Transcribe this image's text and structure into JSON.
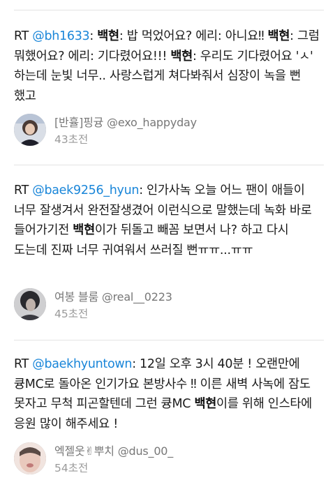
{
  "tweets": [
    {
      "rt": "RT",
      "mention": "@bh1633",
      "segments": [
        {
          "t": ": ",
          "b": false
        },
        {
          "t": "백현",
          "b": true
        },
        {
          "t": ": 밥 먹었어요? 에리: 아니요‼ ",
          "b": false
        },
        {
          "t": "백현",
          "b": true
        },
        {
          "t": ": 그럼 뭐했어요? 에리: 기다렸어요!!! ",
          "b": false
        },
        {
          "t": "백현",
          "b": true
        },
        {
          "t": ": 우리도 기다렸어요 'ㅅ' 하는데 눈빛 너무.. 사랑스럽게 쳐다봐줘서 심장이 녹을 뻔 했고",
          "b": false
        }
      ],
      "author_name": "[반휼]핑귱 @exo_happyday",
      "time": "43초전"
    },
    {
      "rt": "RT",
      "mention": "@baek9256_hyun",
      "segments": [
        {
          "t": ": 인가사녹 오늘 어느 팬이 애들이 너무 잘생겨서 완전잘생겼어 이런식으로 말했는데 녹화 바로 들어가기전 ",
          "b": false
        },
        {
          "t": "백현",
          "b": true
        },
        {
          "t": "이가 뒤돌고 빼꼼 보면서 나? 하고 다시 도는데 진짜 너무 귀여워서 쓰러질 뻔ㅠㅠ...ㅠㅠ",
          "b": false
        }
      ],
      "author_name": "여봉 블룸 @real__0223",
      "time": "45초전"
    },
    {
      "rt": "RT",
      "mention": "@baekhyuntown",
      "segments": [
        {
          "t": ": 12일 오후 3시 40분 ! 오랜만에 큥MC로 돌아온 인기가요 본방사수 ‼ 이른 새벽 사녹에 잠도 못자고 무척 피곤할텐데 그런 큥MC ",
          "b": false
        },
        {
          "t": "백현",
          "b": true
        },
        {
          "t": "이를 위해 인스타에 응원 많이 해주세요 !",
          "b": false
        }
      ],
      "author_name": "엑젤웃✌뿌치 @dus_00_",
      "time": "54초전"
    }
  ],
  "colors": {
    "mention": "#1a86d9",
    "text": "#1b1b1b",
    "meta": "#9a9a9a",
    "divider": "#e3e3e3"
  }
}
